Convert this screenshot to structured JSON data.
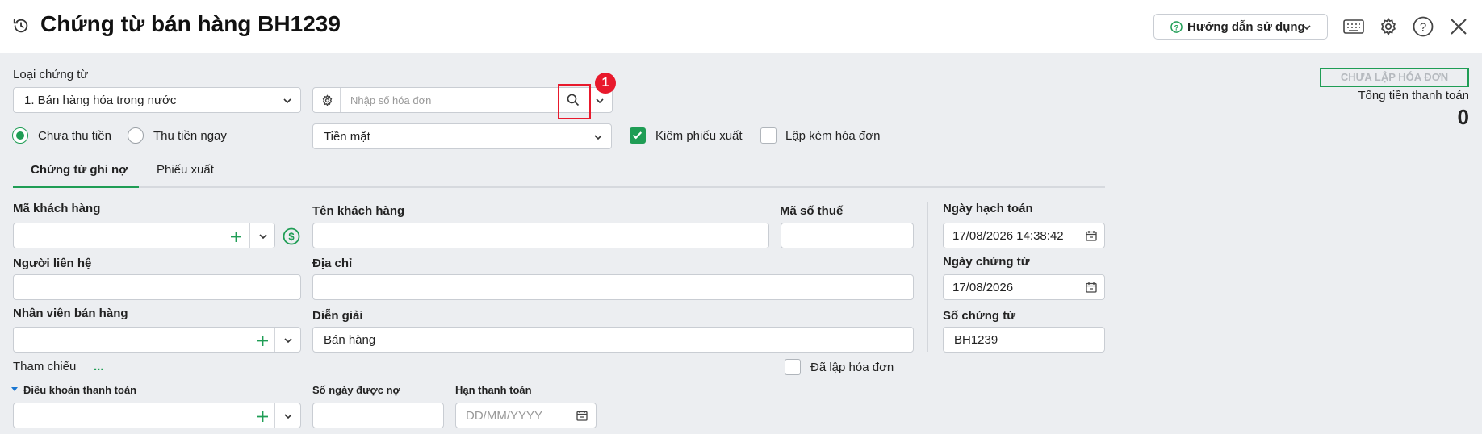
{
  "header": {
    "title": "Chứng từ bán hàng BH1239",
    "help_label": "Hướng dẫn sử dụng"
  },
  "voucher_type": {
    "label": "Loại chứng từ",
    "value": "1. Bán hàng hóa trong nước"
  },
  "invoice_search": {
    "placeholder": "Nhập số hóa đơn",
    "marker": "1"
  },
  "invoice_status": "CHƯA LẬP HÓA ĐƠN",
  "total": {
    "label": "Tổng tiền thanh toán",
    "value": "0"
  },
  "payment": {
    "option_unpaid": "Chưa thu tiền",
    "option_paid_now": "Thu tiền ngay",
    "method": "Tiền mặt",
    "check_export": "Kiêm phiếu xuất",
    "check_invoice": "Lập kèm hóa đơn"
  },
  "tabs": [
    "Chứng từ ghi nợ",
    "Phiếu xuất"
  ],
  "form": {
    "customer_code_label": "Mã khách hàng",
    "customer_name_label": "Tên khách hàng",
    "tax_code_label": "Mã số thuế",
    "contact_label": "Người liên hệ",
    "address_label": "Địa chỉ",
    "salesperson_label": "Nhân viên bán hàng",
    "description_label": "Diễn giải",
    "description_value": "Bán hàng",
    "reference_label": "Tham chiếu",
    "reference_more": "...",
    "invoiced_label": "Đã lập hóa đơn",
    "payment_terms_label": "Điều khoản thanh toán",
    "credit_days_label": "Số ngày được nợ",
    "due_date_label": "Hạn thanh toán",
    "due_date_placeholder": "DD/MM/YYYY"
  },
  "dates": {
    "posting_label": "Ngày hạch toán",
    "posting_value": "17/08/2026 14:38:42",
    "voucher_date_label": "Ngày chứng từ",
    "voucher_date_value": "17/08/2026",
    "voucher_no_label": "Số chứng từ",
    "voucher_no_value": "BH1239"
  },
  "colors": {
    "accent": "#1f9d55",
    "highlight": "#e8192c"
  }
}
